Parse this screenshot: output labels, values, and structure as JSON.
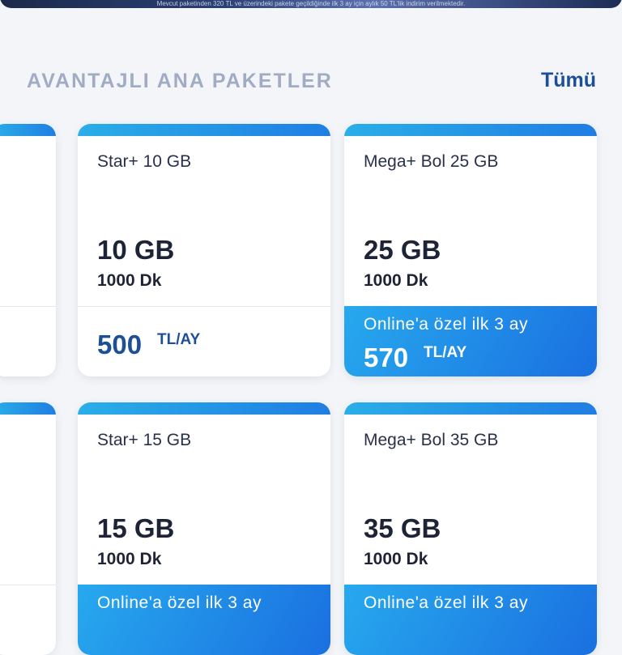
{
  "banner": {
    "text": "Mevcut paketinden 320 TL ve üzerindeki pakete geçildiğinde ilk 3 ay için aylık 50 TL'lik indirim verilmektedir."
  },
  "section": {
    "title": "AVANTAJLI ANA PAKETLER",
    "all_label": "Tümü"
  },
  "cards": [
    {
      "name": "Star+ 10 GB",
      "data": "10 GB",
      "minutes": "1000 Dk",
      "promo": "",
      "price": "500",
      "unit": "TL/AY"
    },
    {
      "name": "Mega+ Bol 25 GB",
      "data": "25 GB",
      "minutes": "1000 Dk",
      "promo": "Online'a özel ilk 3 ay",
      "price": "570",
      "unit": "TL/AY"
    },
    {
      "name": "Star+ 15 GB",
      "data": "15 GB",
      "minutes": "1000 Dk",
      "promo": "Online'a özel ilk 3 ay",
      "price": "",
      "unit": ""
    },
    {
      "name": "Mega+ Bol 35 GB",
      "data": "35 GB",
      "minutes": "1000 Dk",
      "promo": "Online'a özel ilk 3 ay",
      "price": "",
      "unit": ""
    }
  ],
  "colors": {
    "accent": "#1d4f96",
    "gradient_start": "#2aaee8",
    "gradient_end": "#1a6fe0"
  }
}
